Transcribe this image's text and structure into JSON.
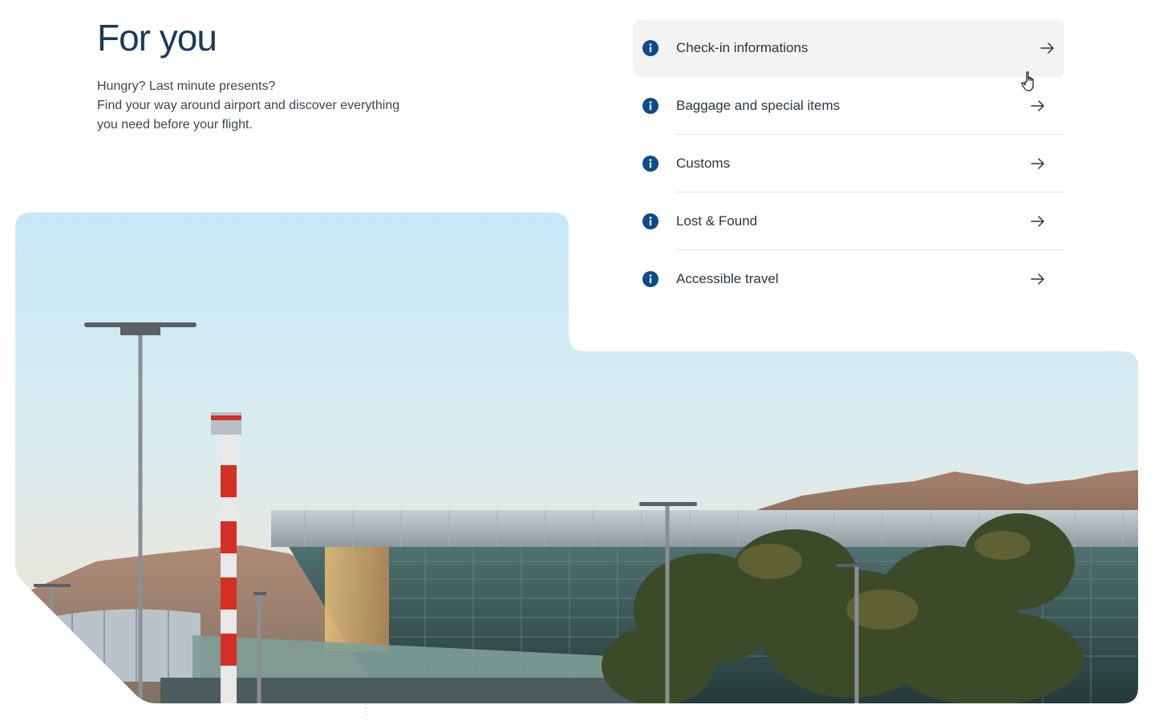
{
  "section": {
    "title": "For you",
    "intro_lines": [
      "Hungry? Last minute presents?",
      "Find your way around airport and discover everything",
      "you need before your flight."
    ]
  },
  "links": [
    {
      "label": "Check-in informations",
      "icon": "info-icon",
      "trailing_icon": "arrow-right-icon",
      "state": "hover"
    },
    {
      "label": "Baggage and special items",
      "icon": "info-icon",
      "trailing_icon": "arrow-right-icon"
    },
    {
      "label": "Customs",
      "icon": "info-icon",
      "trailing_icon": "arrow-right-icon"
    },
    {
      "label": "Lost & Found",
      "icon": "info-icon",
      "trailing_icon": "arrow-right-icon"
    },
    {
      "label": "Accessible travel",
      "icon": "info-icon",
      "trailing_icon": "arrow-right-icon"
    }
  ],
  "hero_image": {
    "description_icon": "airport-terminal-photo"
  },
  "colors": {
    "title": "#1c3a5c",
    "info_icon": "#0d4b8a",
    "hover_bg": "#f3f3f3",
    "divider": "#e3e3e3"
  }
}
